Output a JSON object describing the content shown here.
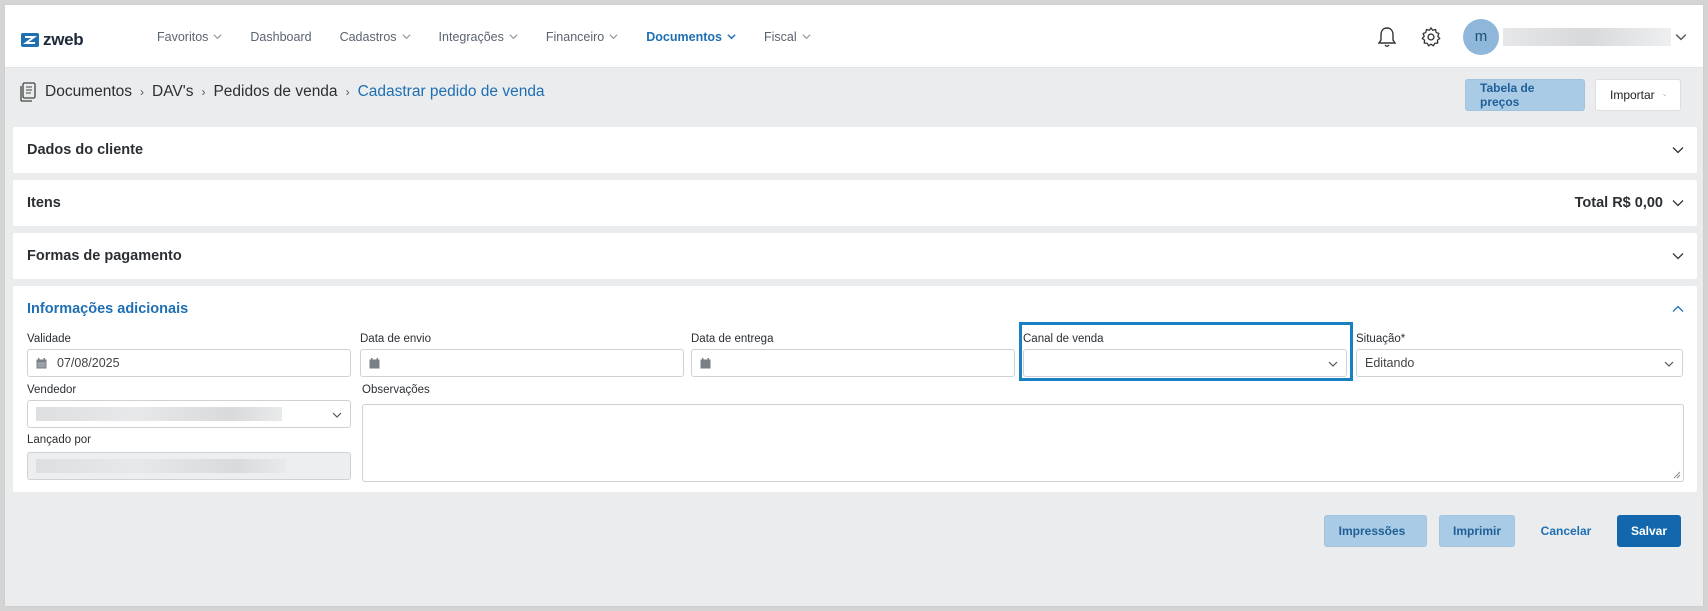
{
  "app": {
    "logo_text": "zweb"
  },
  "nav": {
    "items": [
      {
        "label": "Favoritos",
        "has_menu": true
      },
      {
        "label": "Dashboard",
        "has_menu": false
      },
      {
        "label": "Cadastros",
        "has_menu": true
      },
      {
        "label": "Integrações",
        "has_menu": true
      },
      {
        "label": "Financeiro",
        "has_menu": true
      },
      {
        "label": "Documentos",
        "has_menu": true,
        "active": true
      },
      {
        "label": "Fiscal",
        "has_menu": true
      }
    ]
  },
  "user": {
    "avatar_initial": "m"
  },
  "breadcrumb": {
    "items": [
      "Documentos",
      "DAV's",
      "Pedidos de venda"
    ],
    "current": "Cadastrar pedido de venda"
  },
  "header_actions": {
    "price_table": "Tabela de preços",
    "import": "Importar"
  },
  "sections": {
    "client": "Dados do cliente",
    "items": "Itens",
    "items_total": "Total R$ 0,00",
    "payment": "Formas de pagamento",
    "additional": "Informações adicionais"
  },
  "form": {
    "validade_label": "Validade",
    "validade_value": "07/08/2025",
    "envio_label": "Data de envio",
    "envio_value": "",
    "entrega_label": "Data de entrega",
    "entrega_value": "",
    "canal_label": "Canal de venda",
    "canal_value": "",
    "situacao_label": "Situação*",
    "situacao_value": "Editando",
    "vendedor_label": "Vendedor",
    "obs_label": "Observações",
    "lancado_label": "Lançado por"
  },
  "footer": {
    "impressoes": "Impressões",
    "imprimir": "Imprimir",
    "cancelar": "Cancelar",
    "salvar": "Salvar"
  },
  "colors": {
    "accent": "#1f6fb3",
    "primary_button": "#1267ad",
    "soft_button": "#a9cbe6",
    "highlight": "#1a80c4"
  }
}
